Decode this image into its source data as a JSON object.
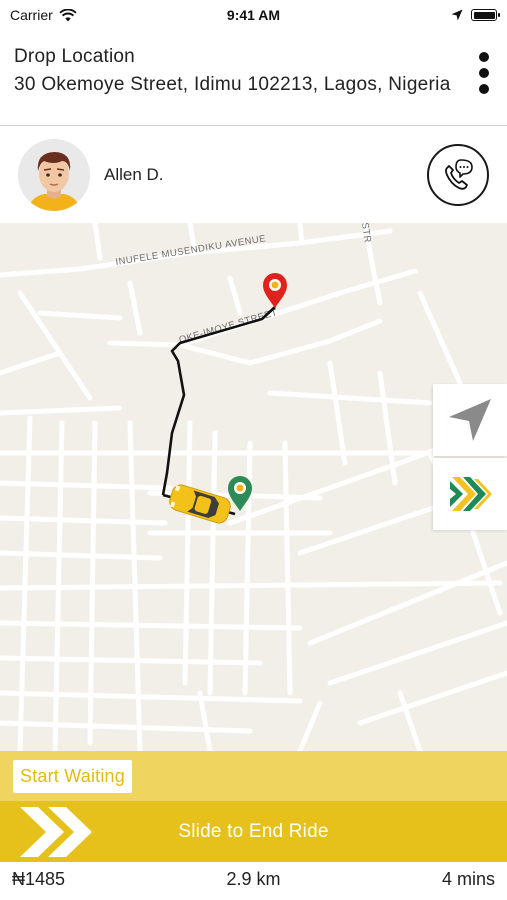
{
  "status_bar": {
    "carrier": "Carrier",
    "time": "9:41 AM"
  },
  "drop": {
    "label": "Drop Location",
    "address": "30 Okemoye Street, Idimu 102213, Lagos, Nigeria"
  },
  "driver": {
    "name": "Allen D."
  },
  "map": {
    "street_labels": [
      "INUFELE MUSENDIKU AVENUE",
      "OKE-IMOYE STREET",
      "STR"
    ],
    "route_color": "#111111",
    "destination_pin_color": "#e0221c",
    "origin_pin_color": "#2e8b57",
    "car_color": "#f2c21a"
  },
  "actions": {
    "start_waiting": "Start Waiting",
    "slide_label": "Slide to End Ride"
  },
  "trip": {
    "fare": "₦1485",
    "distance": "2.9 km",
    "duration": "4 mins"
  },
  "colors": {
    "accent": "#e7c11b",
    "accent_light": "#efd460",
    "map_bg": "#f2efe9"
  }
}
